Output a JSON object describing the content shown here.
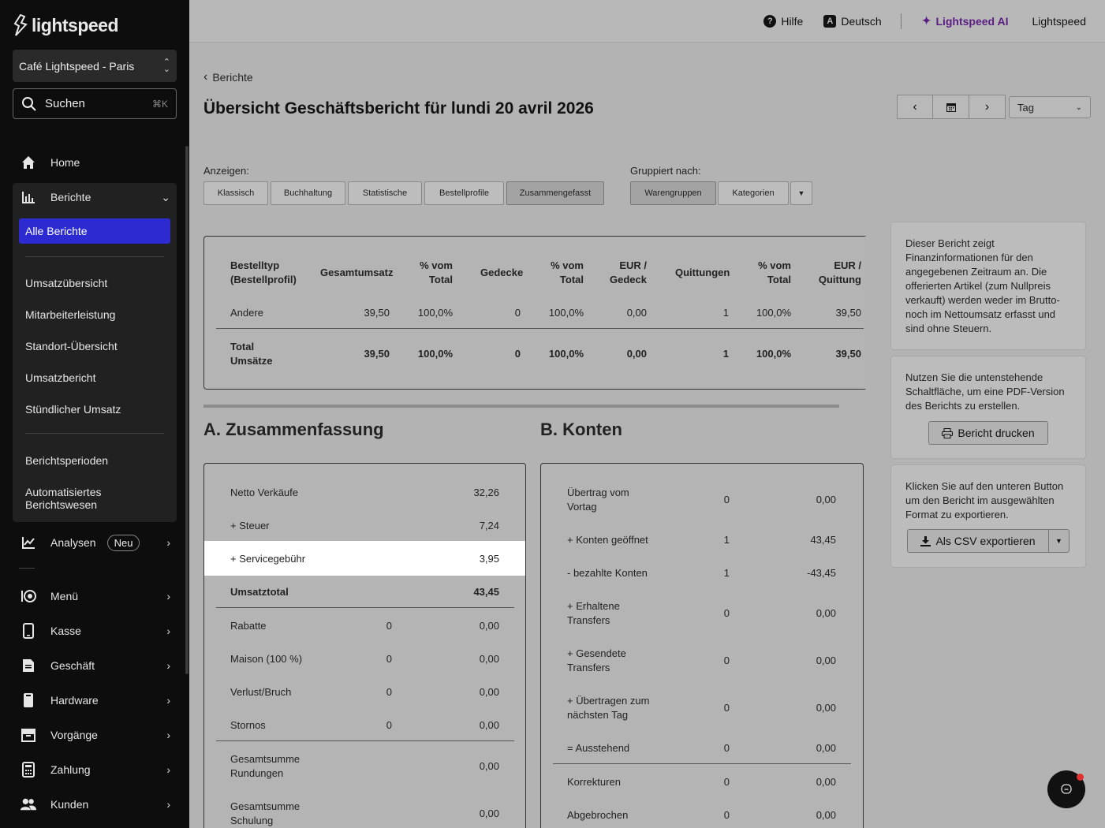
{
  "sidebar": {
    "brand": "lightspeed",
    "location": "Café Lightspeed - Paris",
    "search_label": "Suchen",
    "search_shortcut": "⌘K",
    "home": "Home",
    "berichte": "Berichte",
    "alle_berichte": "Alle Berichte",
    "sub_items": [
      "Umsatzübersicht",
      "Mitarbeiterleistung",
      "Standort-Übersicht",
      "Umsatzbericht",
      "Stündlicher Umsatz"
    ],
    "berichtsperioden": "Berichtsperioden",
    "automatisiert": "Automatisiertes Berichtswesen",
    "analysen": "Analysen",
    "neu_badge": "Neu",
    "menu_items": [
      "Menü",
      "Kasse",
      "Geschäft",
      "Hardware",
      "Vorgänge",
      "Zahlung",
      "Kunden"
    ]
  },
  "topbar": {
    "hilfe": "Hilfe",
    "language": "Deutsch",
    "ai": "Lightspeed AI",
    "account": "Lightspeed"
  },
  "breadcrumb": "Berichte",
  "title": "Übersicht Geschäftsbericht für lundi 20 avril 2026",
  "period_select": "Tag",
  "anzeigen_label": "Anzeigen:",
  "anzeigen_buttons": [
    "Klassisch",
    "Buchhaltung",
    "Statistische",
    "Bestellprofile",
    "Zusammengefasst"
  ],
  "gruppiert_label": "Gruppiert nach:",
  "gruppiert_buttons": [
    "Warengruppen",
    "Kategorien"
  ],
  "top_table": {
    "headers": [
      "Bestelltyp (Bestellprofil)",
      "Gesamtumsatz",
      "% vom Total",
      "Gedecke",
      "% vom Total",
      "EUR / Gedeck",
      "Quittungen",
      "% vom Total",
      "EUR / Quittung"
    ],
    "rows": [
      [
        "Andere",
        "39,50",
        "100,0%",
        "0",
        "100,0%",
        "0,00",
        "1",
        "100,0%",
        "39,50"
      ]
    ],
    "total": [
      "Total Umsätze",
      "39,50",
      "100,0%",
      "0",
      "100,0%",
      "0,00",
      "1",
      "100,0%",
      "39,50"
    ]
  },
  "section_a": {
    "title": "A. Zusammenfassung",
    "rows1": [
      {
        "label": "Netto Verkäufe",
        "value": "32,26"
      },
      {
        "label": "+ Steuer",
        "value": "7,24"
      },
      {
        "label": "+ Servicegebühr",
        "value": "3,95"
      }
    ],
    "total": {
      "label": "Umsatztotal",
      "value": "43,45"
    },
    "rows2": [
      {
        "label": "Rabatte",
        "count": "0",
        "value": "0,00"
      },
      {
        "label": "Maison (100 %)",
        "count": "0",
        "value": "0,00"
      },
      {
        "label": "Verlust/Bruch",
        "count": "0",
        "value": "0,00"
      },
      {
        "label": "Stornos",
        "count": "0",
        "value": "0,00"
      }
    ],
    "rows3": [
      {
        "label": "Gesamtsumme Rundungen",
        "value": "0,00"
      },
      {
        "label": "Gesamtsumme Schulung",
        "value": "0,00"
      }
    ]
  },
  "section_b": {
    "title": "B. Konten",
    "rows1": [
      {
        "label": "Übertrag vom Vortag",
        "count": "0",
        "value": "0,00"
      },
      {
        "label": "+ Konten geöffnet",
        "count": "1",
        "value": "43,45"
      },
      {
        "label": "- bezahlte Konten",
        "count": "1",
        "value": "-43,45"
      },
      {
        "label": "+ Erhaltene Transfers",
        "count": "0",
        "value": "0,00"
      },
      {
        "label": "+ Gesendete Transfers",
        "count": "0",
        "value": "0,00"
      },
      {
        "label": "+ Übertragen zum nächsten Tag",
        "count": "0",
        "value": "0,00"
      },
      {
        "label": "= Ausstehend",
        "count": "0",
        "value": "0,00"
      }
    ],
    "rows2": [
      {
        "label": "Korrekturen",
        "count": "0",
        "value": "0,00"
      },
      {
        "label": "Abgebrochen",
        "count": "0",
        "value": "0,00"
      }
    ]
  },
  "info": {
    "text1": "Dieser Bericht zeigt Finanzinformationen für den angegebenen Zeitraum an. Die offerierten Artikel (zum Nullpreis verkauft) werden weder im Brutto- noch im Nettoumsatz erfasst und sind ohne Steuern.",
    "text2": "Nutzen Sie die untenstehende Schaltfläche, um eine PDF-Version des Berichts zu erstellen.",
    "print_button": "Bericht drucken",
    "text3": "Klicken Sie auf den unteren Button um den Bericht im ausgewählten Format zu exportieren.",
    "export_button": "Als CSV exportieren"
  }
}
